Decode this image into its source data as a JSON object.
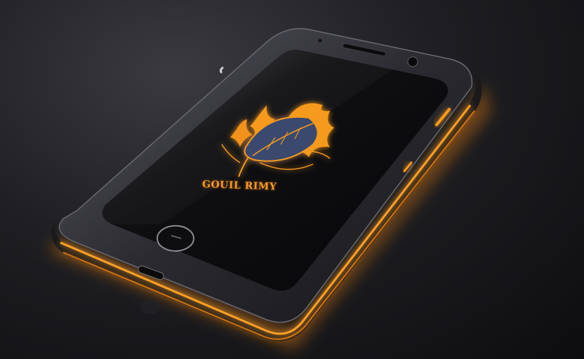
{
  "screen": {
    "brand_text": "GOUIL RIMY"
  },
  "icons": {
    "logo": "flaming-leaf-icon",
    "home_button": "home-button-icon",
    "camera": "camera-icon",
    "speaker": "speaker-grille-icon",
    "port": "charging-port-icon"
  },
  "colors": {
    "background": "#1f1f23",
    "phone_frame": "#2b2b30",
    "screen": "#0b0b0e",
    "accent_glow": "#ff9a1f"
  }
}
